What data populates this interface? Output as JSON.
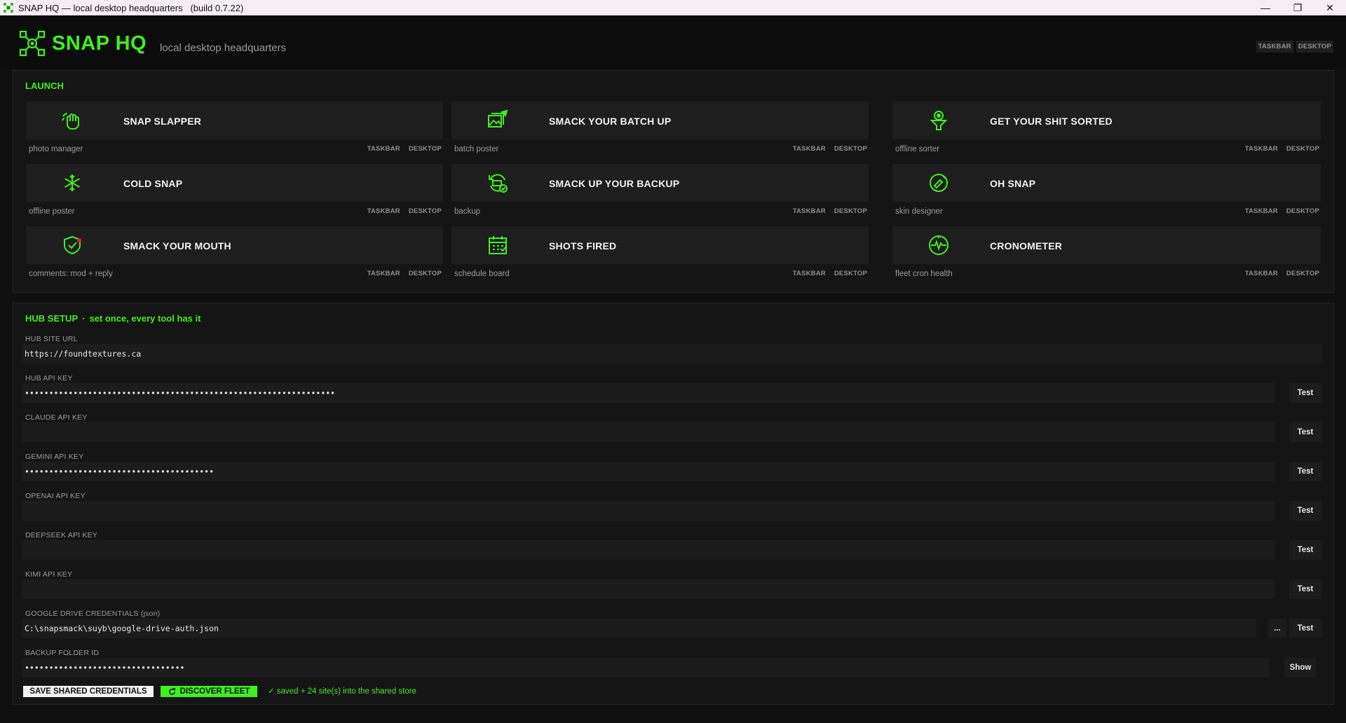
{
  "window": {
    "title": "SNAP HQ — local desktop headquarters   (build 0.7.22)"
  },
  "header": {
    "brand": "SNAP HQ",
    "tagline": "local desktop headquarters",
    "taskbar_label": "TASKBAR",
    "desktop_label": "DESKTOP"
  },
  "launch": {
    "title": "LAUNCH",
    "tools": [
      {
        "name": "SNAP SLAPPER",
        "sub": "photo manager",
        "icon": "hand-slap-icon"
      },
      {
        "name": "SMACK YOUR BATCH UP",
        "sub": "batch poster",
        "icon": "images-batch-icon"
      },
      {
        "name": "GET YOUR SHIT SORTED",
        "sub": "offline sorter",
        "icon": "funnel-sort-icon"
      },
      {
        "name": "COLD SNAP",
        "sub": "offline poster",
        "icon": "snowflake-icon"
      },
      {
        "name": "SMACK UP YOUR BACKUP",
        "sub": "backup",
        "icon": "backup-sync-icon"
      },
      {
        "name": "OH SNAP",
        "sub": "skin designer",
        "icon": "palette-icon"
      },
      {
        "name": "SMACK YOUR MOUTH",
        "sub": "comments: mod + reply",
        "icon": "shield-check-icon"
      },
      {
        "name": "SHOTS FIRED",
        "sub": "schedule board",
        "icon": "calendar-icon"
      },
      {
        "name": "CRONOMETER",
        "sub": "fleet cron health",
        "icon": "pulse-icon"
      }
    ]
  },
  "setup": {
    "title": "HUB SETUP",
    "subtitle": "set once, every tool has it",
    "fields": [
      {
        "label": "HUB SITE URL",
        "value": "https://foundtextures.ca"
      },
      {
        "label": "HUB API KEY",
        "value": "••••••••••••••••••••••••••••••••••••••••••••••••••••••••••••••••",
        "action": "Test"
      },
      {
        "label": "CLAUDE API KEY",
        "value": "",
        "action": "Test"
      },
      {
        "label": "GEMINI API KEY",
        "value": "•••••••••••••••••••••••••••••••••••••••",
        "action": "Test"
      },
      {
        "label": "OPENAI API KEY",
        "value": "",
        "action": "Test"
      },
      {
        "label": "DEEPSEEK API KEY",
        "value": "",
        "action": "Test"
      },
      {
        "label": "KIMI API KEY",
        "value": "",
        "action": "Test"
      },
      {
        "label": "GOOGLE DRIVE CREDENTIALS (json)",
        "value": "C:\\snapsmack\\suyb\\google-drive-auth.json",
        "browse": "...",
        "action": "Test"
      },
      {
        "label": "BACKUP FOLDER ID",
        "value": "•••••••••••••••••••••••••••••••••",
        "action": "Show"
      }
    ],
    "save_label": "SAVE SHARED CREDENTIALS",
    "fleet_label": "DISCOVER FLEET",
    "status": "✓  saved + 24 site(s) into the shared store"
  },
  "colors": {
    "accent": "#3df21a",
    "background": "#0f0f0f",
    "panel": "#151515",
    "card": "#1e1e1e"
  }
}
